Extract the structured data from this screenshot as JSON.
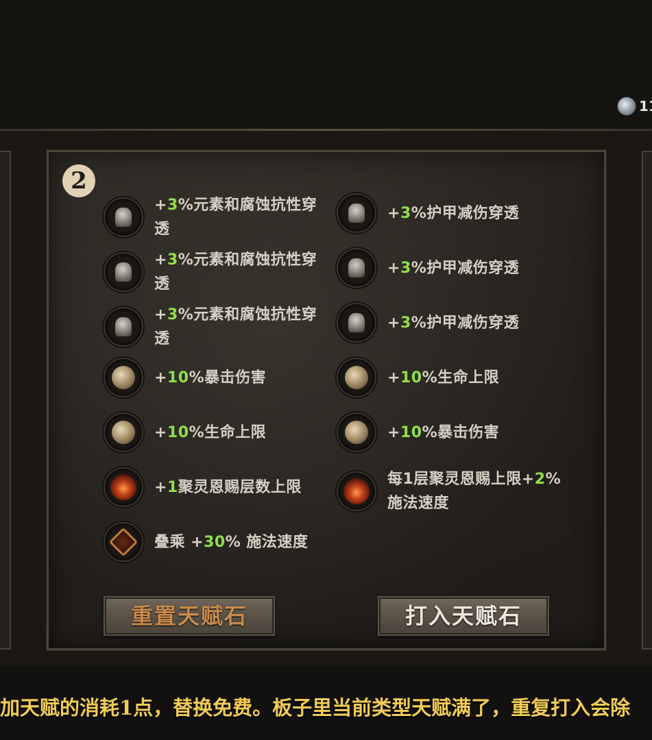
{
  "currency": {
    "icon": "silver-coin-icon",
    "value": "11"
  },
  "panel": {
    "level": "2",
    "talents_left": [
      {
        "icon": "helm-icon",
        "prefix": "+",
        "num": "3",
        "suffix": "%元素和腐蚀抗性穿",
        "line2": "透"
      },
      {
        "icon": "helm-icon",
        "prefix": "+",
        "num": "3",
        "suffix": "%元素和腐蚀抗性穿",
        "line2": "透"
      },
      {
        "icon": "helm-icon",
        "prefix": "+",
        "num": "3",
        "suffix": "%元素和腐蚀抗性穿",
        "line2": "透"
      },
      {
        "icon": "orb-icon",
        "prefix": "+",
        "num": "10",
        "suffix": "%暴击伤害",
        "line2": ""
      },
      {
        "icon": "orb-icon",
        "prefix": "+",
        "num": "10",
        "suffix": "%生命上限",
        "line2": ""
      },
      {
        "icon": "fire-icon",
        "prefix": "+",
        "num": "1",
        "suffix": "聚灵恩赐层数上限",
        "line2": ""
      },
      {
        "icon": "rune-icon",
        "prefix": "叠乘 +",
        "num": "30",
        "suffix": "% 施法速度",
        "line2": ""
      }
    ],
    "talents_right": [
      {
        "icon": "helm-icon",
        "prefix": "+",
        "num": "3",
        "suffix": "%护甲减伤穿透",
        "line2": ""
      },
      {
        "icon": "helm-icon",
        "prefix": "+",
        "num": "3",
        "suffix": "%护甲减伤穿透",
        "line2": ""
      },
      {
        "icon": "helm-icon",
        "prefix": "+",
        "num": "3",
        "suffix": "%护甲减伤穿透",
        "line2": ""
      },
      {
        "icon": "orb-icon",
        "prefix": "+",
        "num": "10",
        "suffix": "%生命上限",
        "line2": ""
      },
      {
        "icon": "orb-icon",
        "prefix": "+",
        "num": "10",
        "suffix": "%暴击伤害",
        "line2": ""
      },
      {
        "icon": "fire-icon",
        "prefix": "每1层聚灵恩赐上限+",
        "num": "2",
        "suffix": "%",
        "line2": "施法速度"
      }
    ],
    "buttons": {
      "reset": "重置天赋石",
      "embed": "打入天赋石"
    }
  },
  "subtitle": "加天赋的消耗1点，替换免费。板子里当前类型天赋满了，重复打入会除",
  "colors": {
    "highlight": "#8fe04a",
    "subtitle": "#f0cc57",
    "reset_text": "#c98a4c"
  }
}
